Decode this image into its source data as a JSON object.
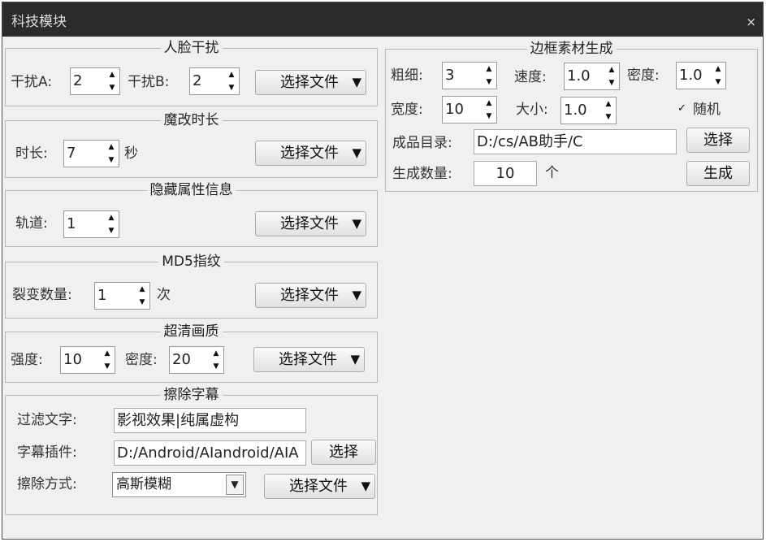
{
  "window": {
    "title": "科技模块",
    "close": "×"
  },
  "face": {
    "title": "人脸干扰",
    "label_a": "干扰A:",
    "value_a": "2",
    "label_b": "干扰B:",
    "value_b": "2",
    "file_button": "选择文件"
  },
  "magic": {
    "title": "魔改时长",
    "label": "时长:",
    "value": "7",
    "unit": "秒",
    "file_button": "选择文件"
  },
  "hidden": {
    "title": "隐藏属性信息",
    "label": "轨道:",
    "value": "1",
    "file_button": "选择文件"
  },
  "md5": {
    "title": "MD5指纹",
    "label": "裂变数量:",
    "value": "1",
    "unit": "次",
    "file_button": "选择文件"
  },
  "hd": {
    "title": "超清画质",
    "label_strength": "强度:",
    "value_strength": "10",
    "label_density": "密度:",
    "value_density": "20",
    "file_button": "选择文件"
  },
  "erase": {
    "title": "擦除字幕",
    "filter_label": "过滤文字:",
    "filter_value": "影视效果|纯属虚构",
    "plugin_label": "字幕插件:",
    "plugin_value": "D:/Android/AIandroid/AIA",
    "plugin_button": "选择",
    "mode_label": "擦除方式:",
    "mode_value": "高斯模糊",
    "file_button": "选择文件"
  },
  "border": {
    "title": "边框素材生成",
    "thickness_label": "粗细:",
    "thickness_value": "3",
    "speed_label": "速度:",
    "speed_value": "1.0",
    "density_label": "密度:",
    "density_value": "1.0",
    "width_label": "宽度:",
    "width_value": "10",
    "size_label": "大小:",
    "size_value": "1.0",
    "random_label": "随机",
    "random_checked": true,
    "output_label": "成品目录:",
    "output_value": "D:/cs/AB助手/C",
    "select_button": "选择",
    "count_label": "生成数量:",
    "count_value": "10",
    "count_unit": "个",
    "generate_button": "生成"
  },
  "icons": {
    "spin_up": "▲",
    "spin_down": "▼",
    "dropdown": "▼",
    "check": "✓"
  }
}
